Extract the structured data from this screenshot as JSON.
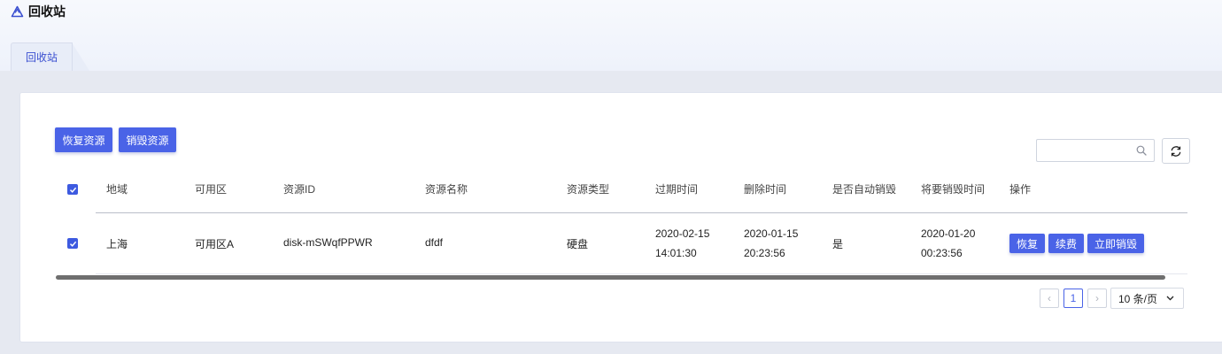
{
  "page": {
    "title": "回收站"
  },
  "tabs": [
    {
      "label": "回收站",
      "active": true
    }
  ],
  "toolbar": {
    "restore_label": "恢复资源",
    "destroy_label": "销毁资源",
    "search_placeholder": "",
    "search_value": ""
  },
  "table": {
    "columns": [
      "地域",
      "可用区",
      "资源ID",
      "资源名称",
      "资源类型",
      "过期时间",
      "删除时间",
      "是否自动销毁",
      "将要销毁时间",
      "操作"
    ],
    "header_checked": true,
    "rows": [
      {
        "checked": true,
        "region": "上海",
        "zone": "可用区A",
        "resource_id": "disk-mSWqfPPWR",
        "resource_name": "dfdf",
        "resource_type": "硬盘",
        "expire_date": "2020-02-15",
        "expire_time": "14:01:30",
        "delete_date": "2020-01-15",
        "delete_time": "20:23:56",
        "auto_destroy": "是",
        "destroy_date": "2020-01-20",
        "destroy_time": "00:23:56",
        "actions": [
          "恢复",
          "续费",
          "立即销毁"
        ]
      }
    ]
  },
  "pagination": {
    "prev": "‹",
    "current_page": "1",
    "next": "›",
    "page_size_label": "10 条/页"
  },
  "colors": {
    "primary": "#4a63e7",
    "tab_text": "#3a4fd0",
    "background_band": "#e6e9f1"
  },
  "icons": [
    "recycle-icon",
    "search-icon",
    "refresh-icon",
    "check-icon",
    "chevron-down-icon"
  ]
}
